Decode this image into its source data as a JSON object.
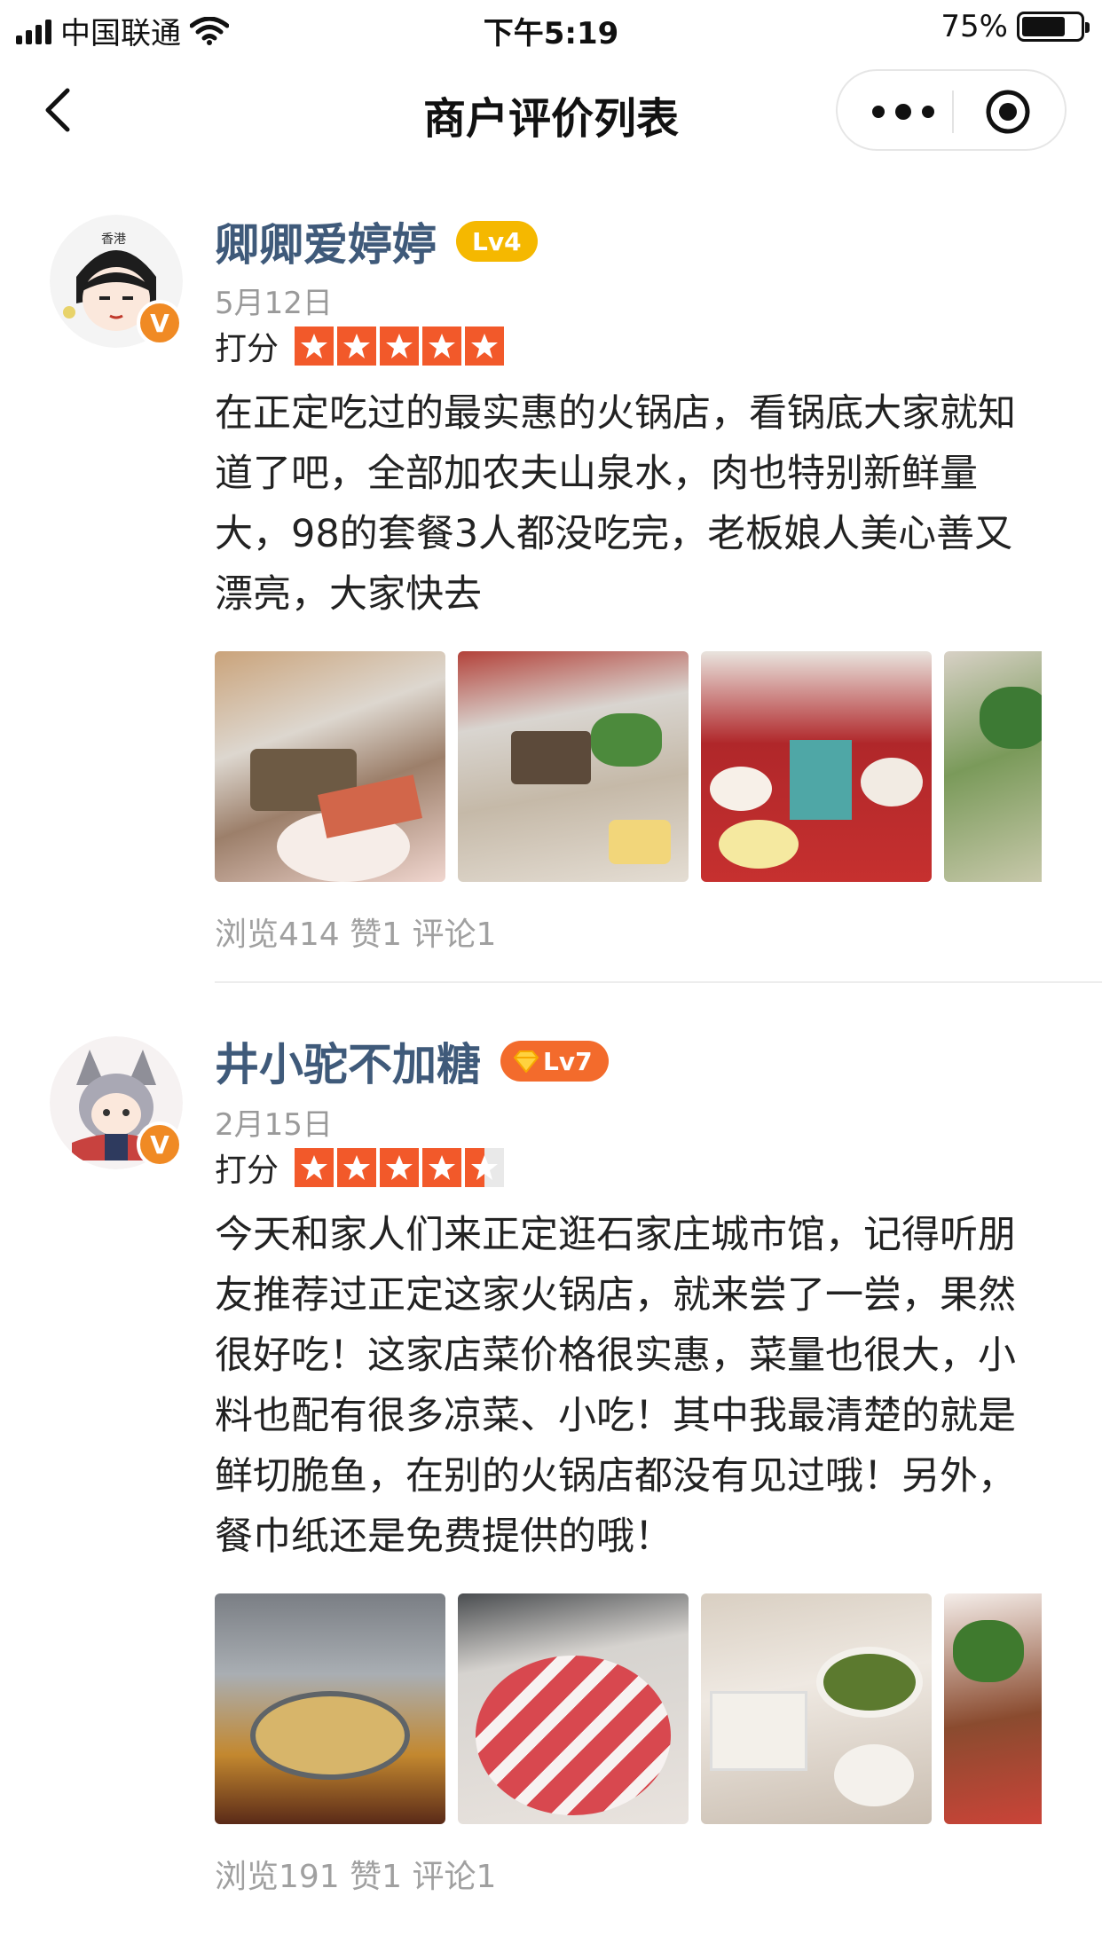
{
  "status_bar": {
    "carrier": "中国联通",
    "time": "下午5:19",
    "battery": "75%",
    "battery_level": 0.75
  },
  "nav": {
    "title": "商户评价列表",
    "icons": [
      "chevron-left-icon",
      "more-dots-icon",
      "target-icon"
    ]
  },
  "reviews": [
    {
      "username": "卿卿爱婷婷",
      "level": "Lv4",
      "date": "5月12日",
      "rating_label": "打分",
      "rating": 5,
      "content": "在正定吃过的最实惠的火锅店，看锅底大家就知道了吧，全部加农夫山泉水，肉也特别新鲜量大，98的套餐3人都没吃完，老板娘人美心善又漂亮，大家快去",
      "stats": "浏览414 赞1 评论1",
      "verified_badge": "V"
    },
    {
      "username": "井小驼不加糖",
      "level": "Lv7",
      "date": "2月15日",
      "rating_label": "打分",
      "rating": 4.5,
      "content": "今天和家人们来正定逛石家庄城市馆，记得听朋友推荐过正定这家火锅店，就来尝了一尝，果然很好吃！这家店菜价格很实惠，菜量也很大，小料也配有很多凉菜、小吃！其中我最清楚的就是鲜切脆鱼，在别的火锅店都没有见过哦！另外，餐巾纸还是免费提供的哦！",
      "stats": "浏览191 赞1 评论1",
      "verified_badge": "V"
    }
  ],
  "colors": {
    "username": "#3f5a7a",
    "star": "#f2592a",
    "lv4": "#f5b800",
    "lv7": "#f36b2c",
    "verified": "#f08a24"
  }
}
